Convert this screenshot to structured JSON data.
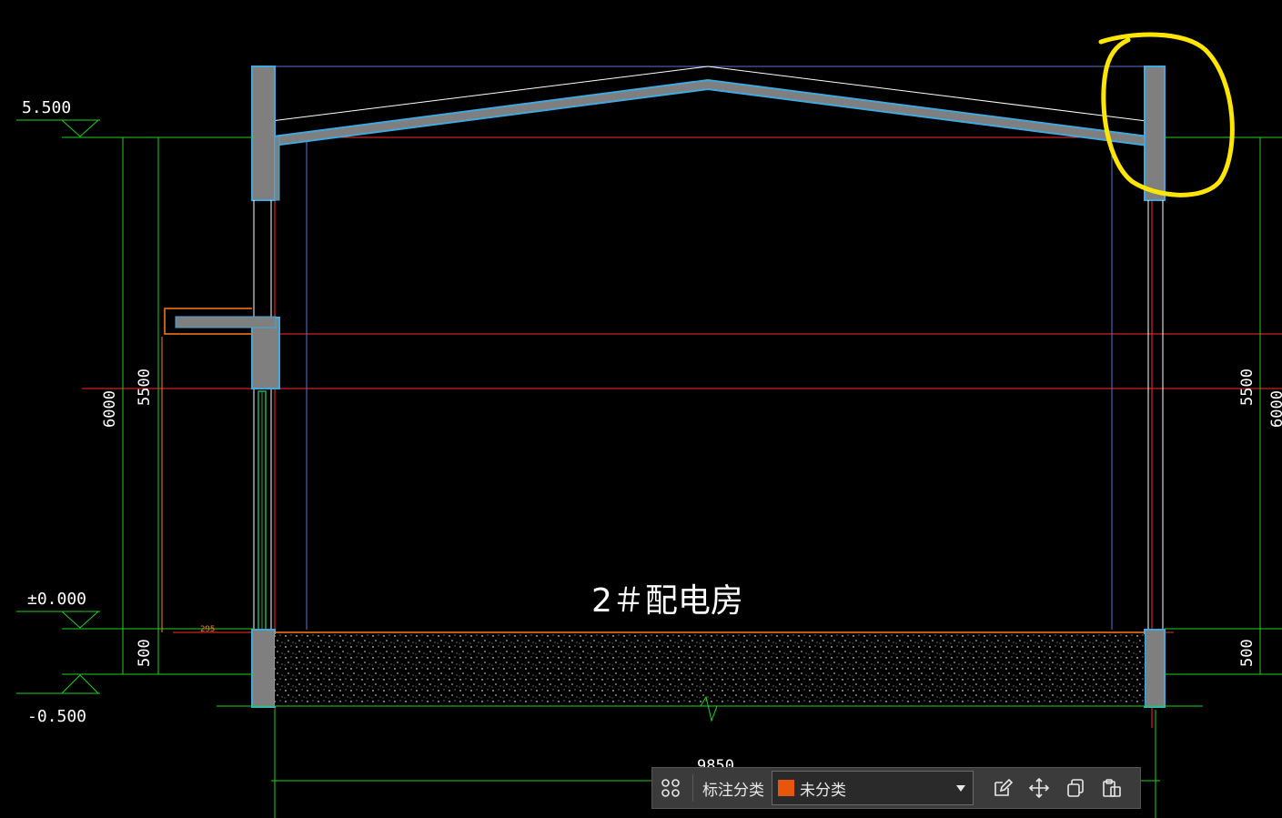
{
  "drawing": {
    "room_label": "2＃配电房",
    "levels": {
      "top": "5.500",
      "ground": "±0.000",
      "bottom": "-0.500"
    },
    "dimensions": {
      "left_total": "6000",
      "left_upper": "5500",
      "left_lower": "500",
      "right_upper": "5500",
      "right_total": "6000",
      "right_lower": "500",
      "span": "9850",
      "small_dim": "295"
    },
    "annotation": "yellow-circle-markup"
  },
  "toolbar": {
    "label": "标注分类",
    "category_value": "未分类",
    "category_color": "#e8560e",
    "icons": [
      "apps-icon",
      "edit-icon",
      "move-icon",
      "copy-icon",
      "paste-icon"
    ]
  },
  "colors": {
    "background": "#000000",
    "wall": "#7f7f7f",
    "wall_outline": "#3fa9e0",
    "axis_red": "#ff2a2a",
    "dim_green": "#1fd11f",
    "markup_yellow": "#ffe600",
    "beam_orange": "#ff7a1a"
  }
}
